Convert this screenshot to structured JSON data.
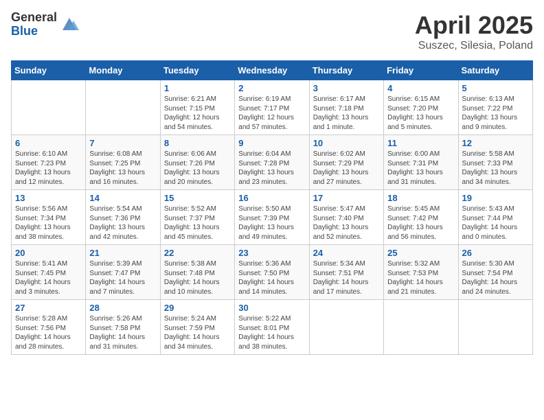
{
  "header": {
    "logo_general": "General",
    "logo_blue": "Blue",
    "month": "April 2025",
    "location": "Suszec, Silesia, Poland"
  },
  "weekdays": [
    "Sunday",
    "Monday",
    "Tuesday",
    "Wednesday",
    "Thursday",
    "Friday",
    "Saturday"
  ],
  "weeks": [
    [
      {
        "day": "",
        "content": ""
      },
      {
        "day": "",
        "content": ""
      },
      {
        "day": "1",
        "content": "Sunrise: 6:21 AM\nSunset: 7:15 PM\nDaylight: 12 hours\nand 54 minutes."
      },
      {
        "day": "2",
        "content": "Sunrise: 6:19 AM\nSunset: 7:17 PM\nDaylight: 12 hours\nand 57 minutes."
      },
      {
        "day": "3",
        "content": "Sunrise: 6:17 AM\nSunset: 7:18 PM\nDaylight: 13 hours\nand 1 minute."
      },
      {
        "day": "4",
        "content": "Sunrise: 6:15 AM\nSunset: 7:20 PM\nDaylight: 13 hours\nand 5 minutes."
      },
      {
        "day": "5",
        "content": "Sunrise: 6:13 AM\nSunset: 7:22 PM\nDaylight: 13 hours\nand 9 minutes."
      }
    ],
    [
      {
        "day": "6",
        "content": "Sunrise: 6:10 AM\nSunset: 7:23 PM\nDaylight: 13 hours\nand 12 minutes."
      },
      {
        "day": "7",
        "content": "Sunrise: 6:08 AM\nSunset: 7:25 PM\nDaylight: 13 hours\nand 16 minutes."
      },
      {
        "day": "8",
        "content": "Sunrise: 6:06 AM\nSunset: 7:26 PM\nDaylight: 13 hours\nand 20 minutes."
      },
      {
        "day": "9",
        "content": "Sunrise: 6:04 AM\nSunset: 7:28 PM\nDaylight: 13 hours\nand 23 minutes."
      },
      {
        "day": "10",
        "content": "Sunrise: 6:02 AM\nSunset: 7:29 PM\nDaylight: 13 hours\nand 27 minutes."
      },
      {
        "day": "11",
        "content": "Sunrise: 6:00 AM\nSunset: 7:31 PM\nDaylight: 13 hours\nand 31 minutes."
      },
      {
        "day": "12",
        "content": "Sunrise: 5:58 AM\nSunset: 7:33 PM\nDaylight: 13 hours\nand 34 minutes."
      }
    ],
    [
      {
        "day": "13",
        "content": "Sunrise: 5:56 AM\nSunset: 7:34 PM\nDaylight: 13 hours\nand 38 minutes."
      },
      {
        "day": "14",
        "content": "Sunrise: 5:54 AM\nSunset: 7:36 PM\nDaylight: 13 hours\nand 42 minutes."
      },
      {
        "day": "15",
        "content": "Sunrise: 5:52 AM\nSunset: 7:37 PM\nDaylight: 13 hours\nand 45 minutes."
      },
      {
        "day": "16",
        "content": "Sunrise: 5:50 AM\nSunset: 7:39 PM\nDaylight: 13 hours\nand 49 minutes."
      },
      {
        "day": "17",
        "content": "Sunrise: 5:47 AM\nSunset: 7:40 PM\nDaylight: 13 hours\nand 52 minutes."
      },
      {
        "day": "18",
        "content": "Sunrise: 5:45 AM\nSunset: 7:42 PM\nDaylight: 13 hours\nand 56 minutes."
      },
      {
        "day": "19",
        "content": "Sunrise: 5:43 AM\nSunset: 7:44 PM\nDaylight: 14 hours\nand 0 minutes."
      }
    ],
    [
      {
        "day": "20",
        "content": "Sunrise: 5:41 AM\nSunset: 7:45 PM\nDaylight: 14 hours\nand 3 minutes."
      },
      {
        "day": "21",
        "content": "Sunrise: 5:39 AM\nSunset: 7:47 PM\nDaylight: 14 hours\nand 7 minutes."
      },
      {
        "day": "22",
        "content": "Sunrise: 5:38 AM\nSunset: 7:48 PM\nDaylight: 14 hours\nand 10 minutes."
      },
      {
        "day": "23",
        "content": "Sunrise: 5:36 AM\nSunset: 7:50 PM\nDaylight: 14 hours\nand 14 minutes."
      },
      {
        "day": "24",
        "content": "Sunrise: 5:34 AM\nSunset: 7:51 PM\nDaylight: 14 hours\nand 17 minutes."
      },
      {
        "day": "25",
        "content": "Sunrise: 5:32 AM\nSunset: 7:53 PM\nDaylight: 14 hours\nand 21 minutes."
      },
      {
        "day": "26",
        "content": "Sunrise: 5:30 AM\nSunset: 7:54 PM\nDaylight: 14 hours\nand 24 minutes."
      }
    ],
    [
      {
        "day": "27",
        "content": "Sunrise: 5:28 AM\nSunset: 7:56 PM\nDaylight: 14 hours\nand 28 minutes."
      },
      {
        "day": "28",
        "content": "Sunrise: 5:26 AM\nSunset: 7:58 PM\nDaylight: 14 hours\nand 31 minutes."
      },
      {
        "day": "29",
        "content": "Sunrise: 5:24 AM\nSunset: 7:59 PM\nDaylight: 14 hours\nand 34 minutes."
      },
      {
        "day": "30",
        "content": "Sunrise: 5:22 AM\nSunset: 8:01 PM\nDaylight: 14 hours\nand 38 minutes."
      },
      {
        "day": "",
        "content": ""
      },
      {
        "day": "",
        "content": ""
      },
      {
        "day": "",
        "content": ""
      }
    ]
  ]
}
